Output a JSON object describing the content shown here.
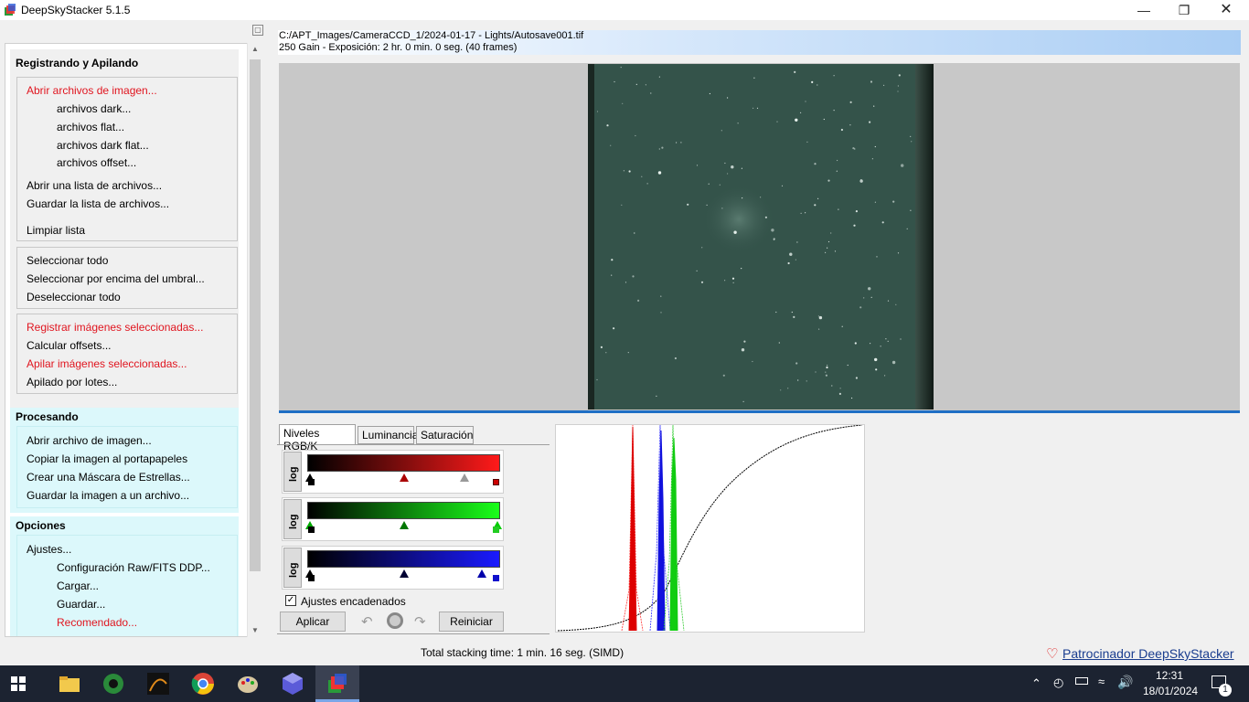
{
  "window": {
    "title": "DeepSkyStacker 5.1.5"
  },
  "left": {
    "reg_header": "Registrando y Apilando",
    "open_group": [
      "Abrir archivos de imagen...",
      "archivos dark...",
      "archivos flat...",
      "archivos dark flat...",
      "archivos offset...",
      "Abrir una lista de archivos...",
      "Guardar la lista de archivos...",
      "Limpiar lista"
    ],
    "select_group": [
      "Seleccionar todo",
      "Seleccionar por encima del umbral...",
      "Deseleccionar todo"
    ],
    "stack_group": [
      "Registrar imágenes seleccionadas...",
      "Calcular offsets...",
      "Apilar imágenes seleccionadas...",
      "Apilado por lotes..."
    ],
    "proc_header": "Procesando",
    "proc_group": [
      "Abrir archivo de imagen...",
      "Copiar la imagen al portapapeles",
      "Crear una Máscara de Estrellas...",
      "Guardar la imagen a un archivo..."
    ],
    "opt_header": "Opciones",
    "opt_group": [
      "Ajustes...",
      "Configuración Raw/FITS DDP...",
      "Cargar...",
      "Guardar...",
      "Recomendado..."
    ]
  },
  "image": {
    "path": "C:/APT_Images/CameraCCD_1/2024-01-17 - Lights/Autosave001.tif",
    "info": "250 Gain - Exposición: 2 hr. 0 min. 0 seg. (40 frames)"
  },
  "tabs": [
    "Niveles RGB/K",
    "Luminancia",
    "Saturación"
  ],
  "levels": {
    "log_label": "log",
    "chained_label": "Ajustes encadenados",
    "chained_checked": true,
    "apply": "Aplicar",
    "reset": "Reiniciar"
  },
  "status": {
    "text": "Total stacking time: 1 min. 16 seg.  (SIMD)",
    "sponsor": "Patrocinador DeepSkyStacker"
  },
  "taskbar": {
    "time": "12:31",
    "date": "18/01/2024",
    "notifications": "1"
  },
  "colors": {
    "accent": "#1f6fc5",
    "link_red": "#e0151f",
    "cyan_panel": "#dcf8fb"
  }
}
